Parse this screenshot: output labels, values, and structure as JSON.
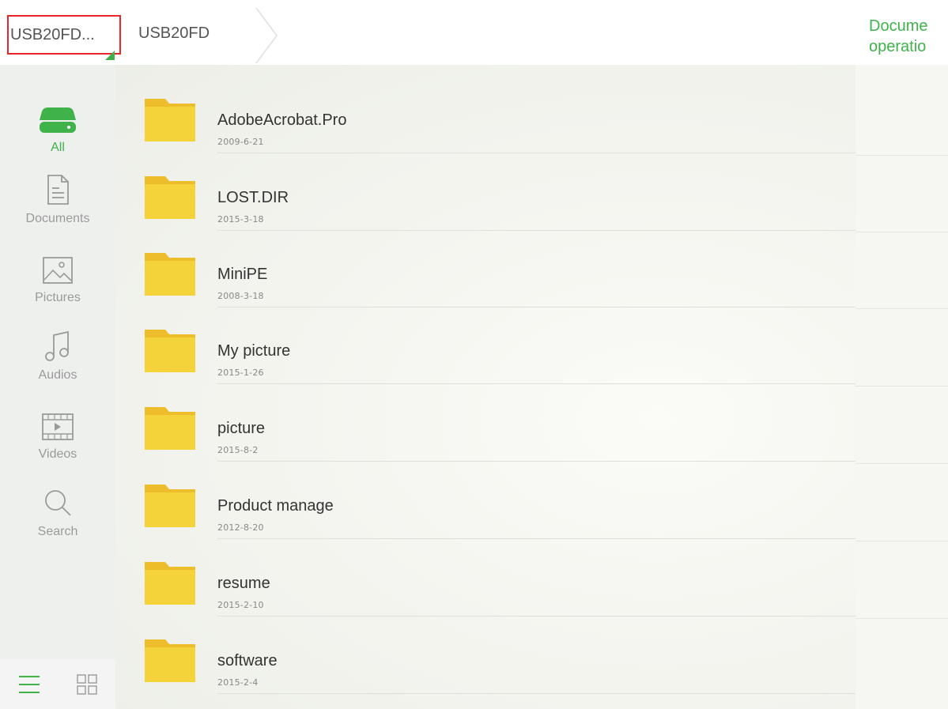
{
  "breadcrumb": {
    "root_label": "USB20FD...",
    "current_label": "USB20FD"
  },
  "header": {
    "doc_ops_line1": "Docume",
    "doc_ops_line2": "operatio"
  },
  "sidebar": {
    "items": [
      {
        "label": "All",
        "icon": "drive-icon",
        "active": true
      },
      {
        "label": "Documents",
        "icon": "document-icon"
      },
      {
        "label": "Pictures",
        "icon": "picture-icon"
      },
      {
        "label": "Audios",
        "icon": "music-icon"
      },
      {
        "label": "Videos",
        "icon": "video-icon"
      },
      {
        "label": "Search",
        "icon": "search-icon"
      }
    ],
    "view_modes": [
      "list-view-icon",
      "grid-view-icon"
    ]
  },
  "files": [
    {
      "name": "AdobeAcrobat.Pro",
      "date": "2009-6-21"
    },
    {
      "name": "LOST.DIR",
      "date": "2015-3-18"
    },
    {
      "name": "MiniPE",
      "date": "2008-3-18"
    },
    {
      "name": "My picture",
      "date": "2015-1-26"
    },
    {
      "name": "picture",
      "date": "2015-8-2"
    },
    {
      "name": "Product manage",
      "date": "2012-8-20"
    },
    {
      "name": "resume",
      "date": "2015-2-10"
    },
    {
      "name": "software",
      "date": "2015-2-4"
    }
  ],
  "colors": {
    "accent": "#3fb24a",
    "folder": "#f4d23a",
    "folder_tab": "#eebd2b",
    "highlight_border": "#e8262a"
  }
}
